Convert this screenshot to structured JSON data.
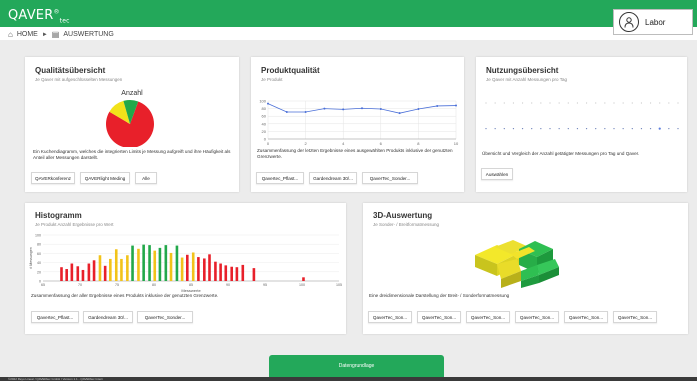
{
  "header": {
    "logo_main": "QAVER",
    "logo_sup": "®",
    "logo_sub": "tec",
    "breadcrumb_home": "HOME",
    "breadcrumb_sep": "►",
    "breadcrumb_page": "AUSWERTUNG",
    "user_name": "Labor",
    "accent": "#23a85a"
  },
  "cards": {
    "quality": {
      "title": "Qualitätsübersicht",
      "subtitle": "Je Qaver mit aufgeschlüsselten Messungen",
      "chart_title": "Anzahl",
      "description": "Ein Kuchendiagramm, welches die integrierten Limits je Messung aufgreift und ihre Häufigkeit als Anteil aller Messungen darstellt.",
      "buttons": [
        "QAVERkonferenz",
        "QAVERlight Meding",
        "Alle"
      ]
    },
    "product": {
      "title": "Produktqualität",
      "subtitle": "Je Produkt",
      "description": "Zusammenfassung der letzten Ergebnisse eines ausgewählten Produkts inklusive der genutzten Grenzwerte.",
      "buttons": [
        "Qavertec_Pflast...",
        "Gardendream 30/...",
        "QaverTec_Sonder..."
      ]
    },
    "usage": {
      "title": "Nutzungsübersicht",
      "subtitle": "Je Qaver mit Anzahl Messungen pro Tag",
      "description": "Übersicht und Vergleich der Anzahl getätigter Messungen pro Tag und Qaver.",
      "buttons": [
        "Auswählen"
      ]
    },
    "histogram": {
      "title": "Histogramm",
      "subtitle": "Je Produkt Anzahl Ergebnisse pro Wert",
      "description": "Zusammenfassung der aller Ergebnisse eines Produkts inklusive der genutzten Grenzwerte.",
      "buttons": [
        "Qavertec_Pflast...",
        "Gardendream 30/...",
        "QaverTec_Sonder..."
      ]
    },
    "threed": {
      "title": "3D-Auswertung",
      "subtitle": "Je Sonder- / Breitformatmessung",
      "description": "Eine dreidimensionale Darstellung der Breit- / Sonderformatmessung",
      "buttons": [
        "QaverTec_Son...",
        "QaverTec_Son...",
        "QaverTec_Son...",
        "QaverTec_Son...",
        "QaverTec_Son...",
        "QaverTec_Son..."
      ]
    }
  },
  "chart_data": [
    {
      "type": "pie",
      "title": "Anzahl",
      "categories": [
        "rot",
        "gelb",
        "grün"
      ],
      "values": [
        78,
        12,
        10
      ],
      "colors": [
        "#e8202a",
        "#f2e21a",
        "#22a84a"
      ]
    },
    {
      "type": "line",
      "title": "",
      "x": [
        0,
        1,
        2,
        3,
        4,
        5,
        6,
        7,
        8,
        9,
        10
      ],
      "series": [
        {
          "values": [
            93,
            71,
            71,
            80,
            78,
            81,
            79,
            68,
            79,
            87,
            88
          ]
        }
      ],
      "ylim": [
        0,
        100
      ],
      "yticks": [
        0,
        20,
        40,
        60,
        80,
        100
      ],
      "xticks": [
        0,
        2,
        4,
        6,
        8,
        10
      ],
      "color": "#4a6fd8"
    },
    {
      "type": "scatter",
      "title": "",
      "series": [
        {
          "values": [
            1,
            1,
            1,
            1,
            1,
            1,
            1,
            1,
            1,
            1,
            1,
            1,
            1,
            1,
            1,
            1,
            1,
            1,
            1,
            1,
            1,
            1
          ]
        },
        {
          "values": [
            0.2,
            0.2,
            0.2,
            0.2,
            0.2,
            0.2,
            0.2,
            0.2,
            0.2,
            0.2,
            0.2,
            0.2,
            0.2,
            0.2,
            0.2,
            0.2,
            0.2,
            0.2,
            0.2,
            0.2,
            0.2,
            0.2
          ]
        }
      ]
    },
    {
      "type": "bar",
      "title": "",
      "xlabel": "Messwerte",
      "ylabel": "# Messungen",
      "xlim": [
        65,
        105
      ],
      "ylim": [
        0,
        100
      ],
      "xticks": [
        65,
        70,
        75,
        80,
        85,
        90,
        95,
        100,
        105
      ],
      "yticks": [
        0,
        20,
        40,
        60,
        80,
        100
      ],
      "x": [
        67.5,
        68.2,
        68.9,
        69.7,
        70.4,
        71.2,
        71.9,
        72.7,
        73.4,
        74.1,
        74.9,
        75.6,
        76.4,
        77.1,
        77.9,
        78.6,
        79.4,
        80.1,
        80.8,
        81.6,
        82.3,
        83.1,
        83.8,
        84.5,
        85.3,
        86.0,
        86.8,
        87.5,
        88.3,
        89.0,
        89.7,
        90.5,
        91.2,
        92.0,
        93.5,
        100.2
      ],
      "values": [
        30,
        26,
        38,
        32,
        24,
        38,
        45,
        56,
        33,
        48,
        69,
        48,
        56,
        77,
        70,
        79,
        78,
        66,
        72,
        78,
        61,
        77,
        51,
        57,
        62,
        52,
        49,
        58,
        42,
        38,
        34,
        31,
        30,
        35,
        28,
        8
      ],
      "colors": [
        "#e8202a",
        "#e8202a",
        "#e8202a",
        "#e8202a",
        "#e8202a",
        "#e8202a",
        "#e8202a",
        "#f2c31a",
        "#e8202a",
        "#f2c31a",
        "#f2c31a",
        "#f2c31a",
        "#f2c31a",
        "#22a84a",
        "#f2c31a",
        "#22a84a",
        "#22a84a",
        "#f2c31a",
        "#22a84a",
        "#22a84a",
        "#f2c31a",
        "#22a84a",
        "#f2c31a",
        "#e8202a",
        "#f2c31a",
        "#e8202a",
        "#e8202a",
        "#e8202a",
        "#e8202a",
        "#e8202a",
        "#e8202a",
        "#e8202a",
        "#e8202a",
        "#e8202a",
        "#e8202a",
        "#e8202a"
      ]
    }
  ],
  "bottom": {
    "tab_label": "Datengrundlage"
  },
  "footer": {
    "text": "©2022 Reyo Linear / QAVERtec GmbH / Version 1.1 - QAVERtec Intern"
  }
}
